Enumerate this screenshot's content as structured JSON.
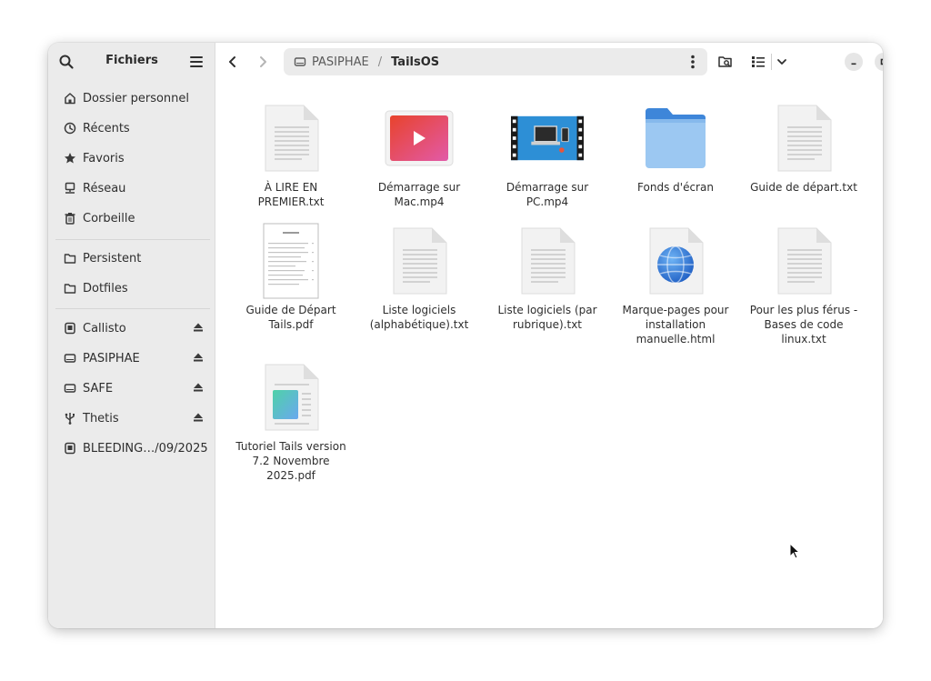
{
  "sidebar": {
    "title": "Fichiers",
    "places": [
      {
        "label": "Dossier personnel",
        "icon": "home-icon"
      },
      {
        "label": "Récents",
        "icon": "clock-icon"
      },
      {
        "label": "Favoris",
        "icon": "star-icon"
      },
      {
        "label": "Réseau",
        "icon": "network-icon"
      },
      {
        "label": "Corbeille",
        "icon": "trash-icon"
      }
    ],
    "bookmarks": [
      {
        "label": "Persistent",
        "icon": "folder-icon"
      },
      {
        "label": "Dotfiles",
        "icon": "folder-icon"
      }
    ],
    "devices": [
      {
        "label": "Callisto",
        "icon": "drive-icon",
        "eject": true
      },
      {
        "label": "PASIPHAE",
        "icon": "drive-icon",
        "eject": true
      },
      {
        "label": "SAFE",
        "icon": "drive-icon",
        "eject": true
      },
      {
        "label": "Thetis",
        "icon": "usb-icon",
        "eject": true
      },
      {
        "label": "BLEEDING…/09/2025",
        "icon": "drive-icon",
        "eject": false
      }
    ]
  },
  "path": {
    "segments": [
      "PASIPHAE",
      "TailsOS"
    ],
    "separator": "/"
  },
  "files": [
    {
      "name": "À LIRE EN PREMIER.txt",
      "type": "text"
    },
    {
      "name": "Démarrage sur Mac.mp4",
      "type": "video"
    },
    {
      "name": "Démarrage sur PC.mp4",
      "type": "video-pc"
    },
    {
      "name": "Fonds d'écran",
      "type": "folder"
    },
    {
      "name": "Guide de départ.txt",
      "type": "text"
    },
    {
      "name": "Guide de Départ Tails.pdf",
      "type": "pdf-doc"
    },
    {
      "name": "Liste logiciels (alphabétique).txt",
      "type": "text"
    },
    {
      "name": "Liste logiciels (par rubrique).txt",
      "type": "text"
    },
    {
      "name": "Marque-pages pour installation manuelle.html",
      "type": "html"
    },
    {
      "name": "Pour les plus férus - Bases de code linux.txt",
      "type": "text"
    },
    {
      "name": "Tutoriel Tails version 7.2 Novembre 2025.pdf",
      "type": "pdf-image"
    }
  ],
  "colors": {
    "sidebar_bg": "#ebebeb",
    "folder_blue": "#5aa0e6",
    "accent": "#3584e4"
  }
}
